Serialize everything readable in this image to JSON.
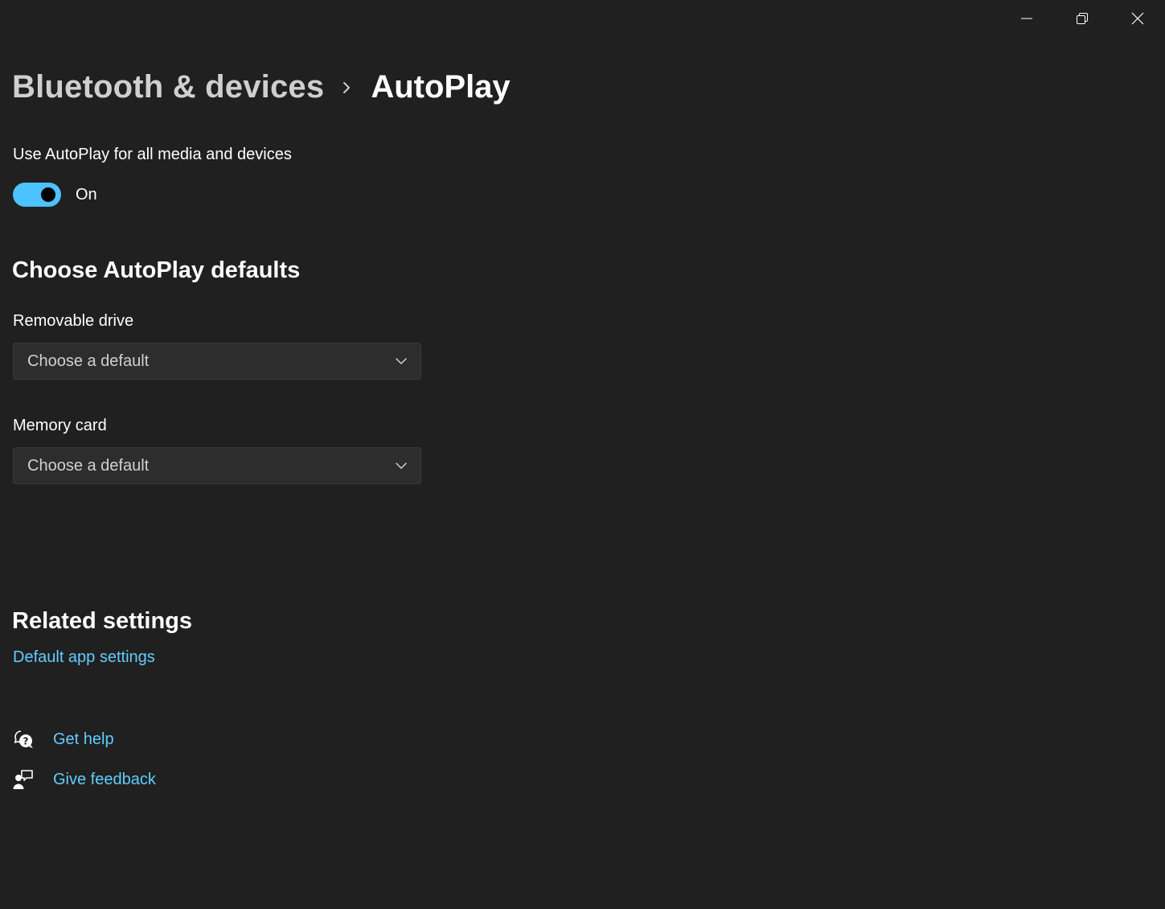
{
  "window": {
    "minimize_icon": "minimize-icon",
    "maximize_icon": "restore-icon",
    "close_icon": "close-icon"
  },
  "breadcrumb": {
    "parent": "Bluetooth & devices",
    "separator_icon": "chevron-right-icon",
    "current": "AutoPlay"
  },
  "autoplay": {
    "label": "Use AutoPlay for all media and devices",
    "toggle_state": "On",
    "toggle_on": true
  },
  "defaults": {
    "title": "Choose AutoPlay defaults",
    "removable_drive": {
      "label": "Removable drive",
      "value": "Choose a default"
    },
    "memory_card": {
      "label": "Memory card",
      "value": "Choose a default"
    }
  },
  "related": {
    "title": "Related settings",
    "link": "Default app settings"
  },
  "help": {
    "get_help": "Get help",
    "give_feedback": "Give feedback"
  },
  "colors": {
    "background": "#202020",
    "accent": "#4cc2ff",
    "link": "#60cdff",
    "combo_bg": "#2d2d2d"
  }
}
